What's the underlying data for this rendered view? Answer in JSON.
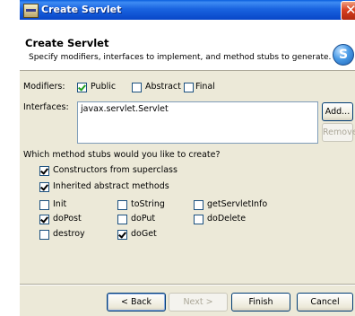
{
  "window": {
    "title": "Create Servlet"
  },
  "banner": {
    "title": "Create Servlet",
    "description": "Specify modifiers, interfaces to implement, and method stubs to generate.",
    "logo_letter": "S",
    "logo_icon": "servlet-wizard-icon"
  },
  "modifiers": {
    "label": "Modifiers:",
    "options": [
      {
        "label": "Public",
        "checked": true
      },
      {
        "label": "Abstract",
        "checked": false
      },
      {
        "label": "Final",
        "checked": false
      }
    ]
  },
  "interfaces": {
    "label": "Interfaces:",
    "items": [
      "javax.servlet.Servlet"
    ],
    "add_label": "Add...",
    "remove_label": "Remove"
  },
  "stubs": {
    "question": "Which method stubs would you like to create?",
    "general": [
      {
        "label": "Constructors from superclass",
        "checked": true
      },
      {
        "label": "Inherited abstract methods",
        "checked": true
      }
    ],
    "methods": [
      {
        "label": "Init",
        "checked": false
      },
      {
        "label": "toString",
        "checked": false
      },
      {
        "label": "getServletInfo",
        "checked": false
      },
      {
        "label": "doPost",
        "checked": true
      },
      {
        "label": "doPut",
        "checked": false
      },
      {
        "label": "doDelete",
        "checked": false
      },
      {
        "label": "destroy",
        "checked": false
      },
      {
        "label": "doGet",
        "checked": true
      }
    ]
  },
  "footer": {
    "back_label": "< Back",
    "next_label": "Next >",
    "finish_label": "Finish",
    "cancel_label": "Cancel"
  }
}
